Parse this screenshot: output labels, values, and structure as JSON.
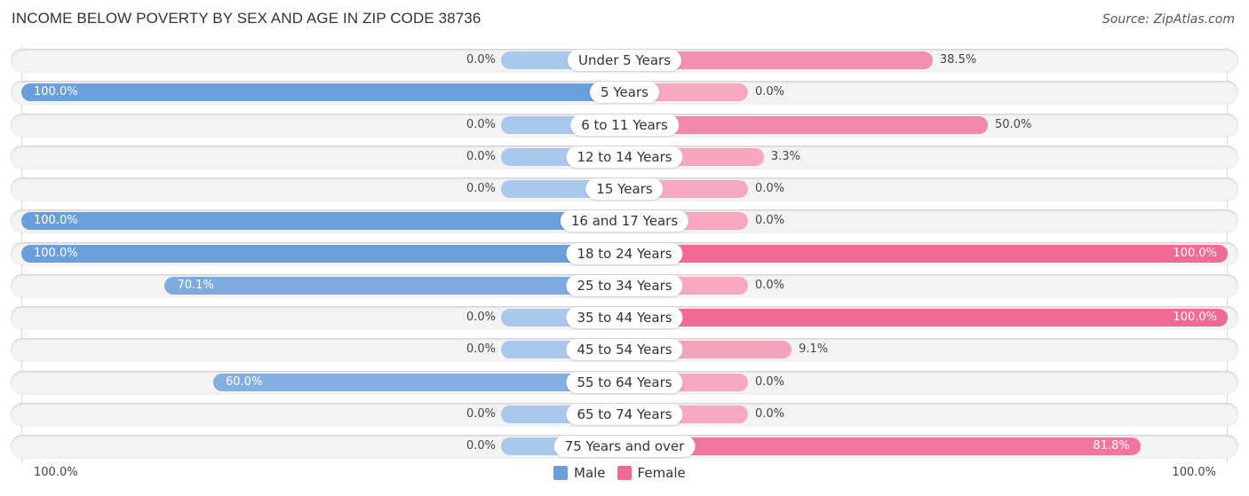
{
  "title": "INCOME BELOW POVERTY BY SEX AND AGE IN ZIP CODE 38736",
  "source": "Source: ZipAtlas.com",
  "colors": {
    "male": "#6a9fdb",
    "male_light": "#a9c8ec",
    "female": "#f06a94",
    "female_light": "#f6a8c0"
  },
  "axis": {
    "left_label": "100.0%",
    "right_label": "100.0%"
  },
  "legend": [
    {
      "label": "Male",
      "color": "#6a9fdb"
    },
    {
      "label": "Female",
      "color": "#f06a94"
    }
  ],
  "chart_data": {
    "type": "bar",
    "orientation": "horizontal-diverging",
    "title": "INCOME BELOW POVERTY BY SEX AND AGE IN ZIP CODE 38736",
    "categories": [
      "Under 5 Years",
      "5 Years",
      "6 to 11 Years",
      "12 to 14 Years",
      "15 Years",
      "16 and 17 Years",
      "18 to 24 Years",
      "25 to 34 Years",
      "35 to 44 Years",
      "45 to 54 Years",
      "55 to 64 Years",
      "65 to 74 Years",
      "75 Years and over"
    ],
    "series": [
      {
        "name": "Male",
        "values": [
          0.0,
          100.0,
          0.0,
          0.0,
          0.0,
          100.0,
          100.0,
          70.1,
          0.0,
          0.0,
          60.0,
          0.0,
          0.0
        ],
        "labels": [
          "0.0%",
          "100.0%",
          "0.0%",
          "0.0%",
          "0.0%",
          "100.0%",
          "100.0%",
          "70.1%",
          "0.0%",
          "0.0%",
          "60.0%",
          "0.0%",
          "0.0%"
        ]
      },
      {
        "name": "Female",
        "values": [
          38.5,
          0.0,
          50.0,
          3.3,
          0.0,
          0.0,
          100.0,
          0.0,
          100.0,
          9.1,
          0.0,
          0.0,
          81.8
        ],
        "labels": [
          "38.5%",
          "0.0%",
          "50.0%",
          "3.3%",
          "0.0%",
          "0.0%",
          "100.0%",
          "0.0%",
          "100.0%",
          "9.1%",
          "0.0%",
          "0.0%",
          "81.8%"
        ]
      }
    ],
    "xlim": [
      0,
      100
    ],
    "xlabel_left": "100.0%",
    "xlabel_right": "100.0%",
    "legend_position": "bottom-center",
    "grid": false
  }
}
